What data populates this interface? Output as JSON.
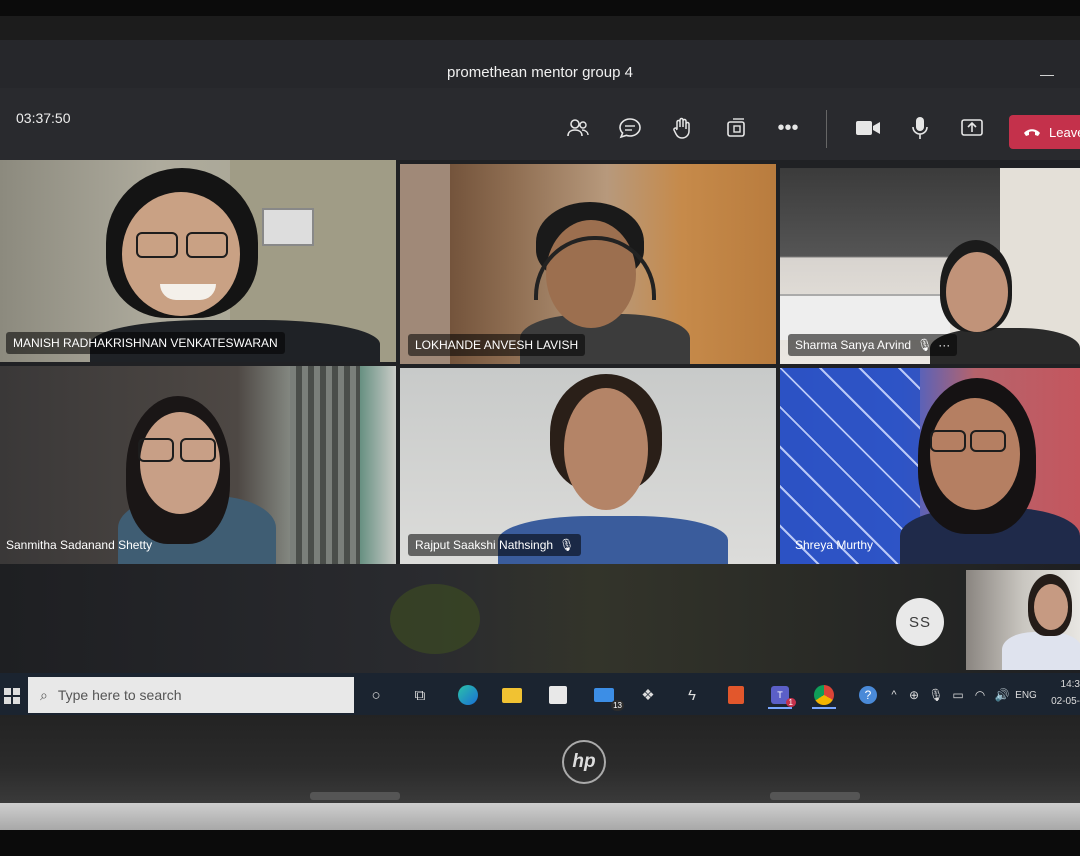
{
  "window": {
    "title": "promethean mentor group 4",
    "minimize_icon": "minimize-icon"
  },
  "toolbar": {
    "timer": "03:37:50",
    "icons": [
      "participants-icon",
      "chat-icon",
      "raise-hand-icon",
      "share-tray-icon",
      "more-icon",
      "camera-icon",
      "mic-icon",
      "share-screen-icon"
    ],
    "leave_label": "Leave",
    "leave_color": "#c4314b"
  },
  "participants": [
    {
      "name": "MANISH RADHAKRISHNAN VENKATESWARAN",
      "muted": false
    },
    {
      "name": "LOKHANDE ANVESH LAVISH",
      "muted": false
    },
    {
      "name": "Sharma Sanya Arvind",
      "muted": true,
      "more": "···"
    },
    {
      "name": "Sanmitha Sadanand Shetty",
      "muted": false
    },
    {
      "name": "Rajput Saakshi Nathsingh",
      "muted": true
    },
    {
      "name": "Shreya Murthy",
      "muted": false
    }
  ],
  "avatar": {
    "initials": "SS"
  },
  "taskbar": {
    "search_placeholder": "Type here to search",
    "mail_badge": "13",
    "teams_badge": "1",
    "language": "ENG",
    "time": "14:3",
    "date": "02-05-"
  },
  "laptop": {
    "brand": "hp"
  },
  "colors": {
    "teams_bg": "#202124",
    "leave_red": "#c4314b",
    "taskbar": "#1b2430"
  }
}
